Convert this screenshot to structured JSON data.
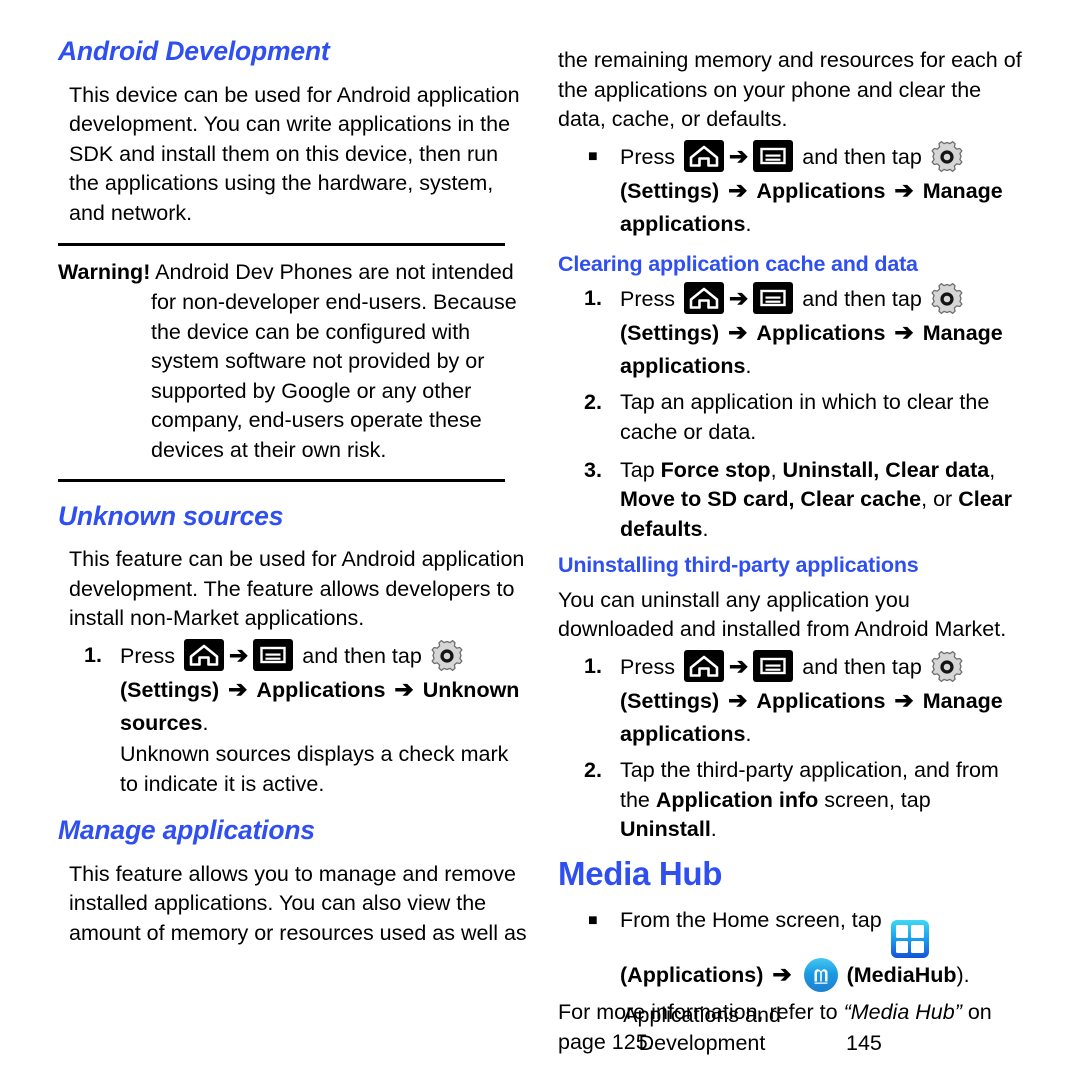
{
  "colors": {
    "heading_blue": "#2f4ff0",
    "text_black": "#000000",
    "page_background": "#ffffff",
    "icon_black": "#000000",
    "gear_gray": "#d2d2d2",
    "apps_icon_gradient_top": "#3ed8f3",
    "apps_icon_gradient_bottom": "#1452d8",
    "mediahub_icon_gradient_top": "#44c8f0",
    "mediahub_icon_gradient_bottom": "#1e7fd0"
  },
  "icons": {
    "home": "home-key-icon",
    "menu": "menu-key-icon",
    "gear": "settings-gear-icon",
    "arrow": "➔",
    "applications": "applications-grid-icon",
    "mediahub": "mediahub-app-icon",
    "bullet": "■"
  },
  "left_column": {
    "android_development": {
      "heading": "Android Development",
      "paragraph": "This device can be used for Android application development. You can write applications in the SDK and install them on this device, then run the applications using the hardware, system, and network."
    },
    "warning": {
      "label": "Warning!",
      "text": "Android Dev Phones are not intended for non-developer end-users. Because the device can be configured with system software not provided by or supported by Google or any other company, end-users operate these devices at their own risk."
    },
    "unknown_sources": {
      "heading": "Unknown sources",
      "paragraph": "This feature can be used for Android application development. The feature allows developers to install non-Market applications.",
      "step1": {
        "marker": "1.",
        "press_label": "Press",
        "and_then_tap": "and then tap",
        "settings_open_paren": "(",
        "settings": "Settings",
        "settings_close_paren": ")",
        "applications": "Applications",
        "unknown_sources": "Unknown sources",
        "period": "."
      },
      "step1_note": "Unknown sources displays a check mark to indicate it is active."
    },
    "manage_applications": {
      "heading": "Manage applications",
      "paragraph": "This feature allows you to manage and remove installed applications. You can also view the amount of memory or resources used as well as"
    }
  },
  "right_column": {
    "manage_applications_cont": {
      "paragraph": "the remaining memory and resources for each of the applications on your phone and clear the data, cache, or defaults.",
      "bullet": {
        "marker": "■",
        "press_label": "Press",
        "and_then_tap": "and then tap",
        "settings_open_paren": "(",
        "settings": "Settings",
        "settings_close_paren": ")",
        "applications": "Applications",
        "manage_applications": "Manage applications",
        "period": "."
      }
    },
    "clearing_cache": {
      "heading": "Clearing application cache and data",
      "step1": {
        "marker": "1.",
        "press_label": "Press",
        "and_then_tap": "and then tap",
        "settings_open_paren": "(",
        "settings": "Settings",
        "settings_close_paren": ")",
        "applications": "Applications",
        "manage_applications": "Manage applications",
        "period": "."
      },
      "step2": {
        "marker": "2.",
        "text": "Tap an application in which to clear the cache or data."
      },
      "step3": {
        "marker": "3.",
        "tap_label": "Tap",
        "opt1": "Force stop",
        "sep1": ", ",
        "opt2": "Uninstall, Clear data",
        "sep2": ", ",
        "opt3": "Move to SD card, Clear cache",
        "sep3": ", ",
        "or_label": "or",
        "opt4": "Clear defaults",
        "period": "."
      }
    },
    "uninstalling": {
      "heading": "Uninstalling third-party applications",
      "paragraph": "You can uninstall any application you downloaded and installed from Android Market.",
      "step1": {
        "marker": "1.",
        "press_label": "Press",
        "and_then_tap": "and then tap",
        "settings_open_paren": "(",
        "settings": "Settings",
        "settings_close_paren": ")",
        "applications": "Applications",
        "manage_applications": "Manage applications",
        "period": "."
      },
      "step2": {
        "marker": "2.",
        "text_a": "Tap the third-party application, and from the ",
        "app_info": "Application info",
        "text_b": " screen, tap ",
        "uninstall": "Uninstall",
        "period": "."
      }
    },
    "media_hub": {
      "heading": "Media Hub",
      "bullet": {
        "marker": "■",
        "text_a": "From the Home screen, tap",
        "applications_open_paren": "(",
        "applications": "Applications",
        "applications_close_paren": ")",
        "mediahub_open_paren": "(",
        "mediahub": "MediaHub",
        "mediahub_close_paren": ")",
        "period": "."
      },
      "note_a": "For more information, refer to ",
      "note_ref": "“Media Hub”",
      "note_b": " on page 125."
    }
  },
  "footer": {
    "title": "Applications and Development",
    "page_number": "145"
  }
}
